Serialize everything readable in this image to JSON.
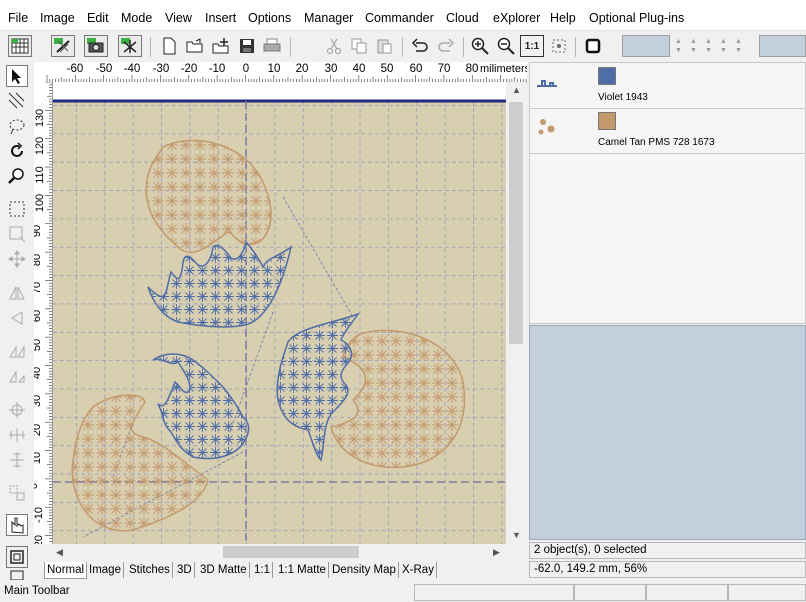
{
  "menu": [
    "File",
    "Image",
    "Edit",
    "Mode",
    "View",
    "Insert",
    "Options",
    "Manager",
    "Commander",
    "Cloud",
    "eXplorer",
    "Help",
    "Optional Plug-ins"
  ],
  "toolbar": {
    "buttons": [
      "grid-stitch-icon",
      "stitch-wand-icon",
      "camera-icon",
      "stitch-delete-icon",
      "new-icon",
      "open-icon",
      "add-icon",
      "save-icon",
      "print-icon",
      "cut-icon",
      "copy-icon",
      "paste-icon",
      "undo-icon",
      "redo-icon",
      "zoom-in-icon",
      "zoom-out-icon",
      "zoom-1-1-icon",
      "select-area-icon",
      "stop-icon"
    ],
    "zoom_1_1_label": "1:1"
  },
  "ruler": {
    "h_labels": [
      "-60",
      "-50",
      "-40",
      "-30",
      "-20",
      "-10",
      "0",
      "10",
      "20",
      "30",
      "40",
      "50",
      "60",
      "70",
      "80"
    ],
    "h_unit": "milimeters",
    "v_labels": [
      "130",
      "120",
      "110",
      "100",
      "90",
      "80",
      "70",
      "60",
      "50",
      "40",
      "30",
      "20",
      "10",
      "0",
      "-10",
      "-20"
    ]
  },
  "tabs": [
    "Normal",
    "Image",
    "Stitches",
    "3D",
    "3D Matte",
    "1:1",
    "1:1 Matte",
    "Density Map",
    "X-Ray"
  ],
  "selected_tab": "Normal",
  "colors": [
    {
      "name": "Violet 1943",
      "hex": "#4f6ea8"
    },
    {
      "name": "Camel Tan PMS 728 1673",
      "hex": "#c49a6c"
    }
  ],
  "theme": {
    "canvas_bg": "#d8ceb0",
    "grid": "#9a9cc0",
    "blue_thread": "#4f6ea8",
    "tan_thread": "#c49a6c",
    "hoop_line": "#1e2a80",
    "preview_bg": "#c3cfdd"
  },
  "status": {
    "objects": "2 object(s), 0 selected",
    "coords": "-62.0, 149.2 mm, 56%",
    "main_toolbar": "Main Toolbar"
  }
}
